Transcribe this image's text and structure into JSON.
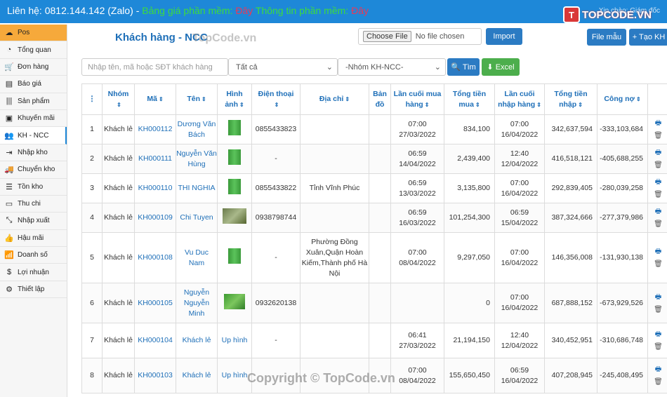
{
  "topbar": {
    "contact_label": "Liên hệ: 0812.144.142 (Zalo) -",
    "price_label": "Bảng giá phần mềm:",
    "price_link": "Đây",
    "info_label": "Thông tin phần mềm:",
    "info_link": "Đây",
    "welcome": "Xin chào: Giám đốc",
    "logo_mark": "T",
    "logo_text": "TOPCODE.VN"
  },
  "sidebar": {
    "items": [
      {
        "label": "Pos",
        "icon": "cloud-icon"
      },
      {
        "label": "Tổng quan",
        "icon": "dashboard-icon"
      },
      {
        "label": "Đơn hàng",
        "icon": "cart-icon"
      },
      {
        "label": "Báo giá",
        "icon": "document-icon"
      },
      {
        "label": "Sản phẩm",
        "icon": "barcode-icon"
      },
      {
        "label": "Khuyến mãi",
        "icon": "gift-icon"
      },
      {
        "label": "KH - NCC",
        "icon": "users-icon"
      },
      {
        "label": "Nhập kho",
        "icon": "import-icon"
      },
      {
        "label": "Chuyển kho",
        "icon": "truck-icon"
      },
      {
        "label": "Tồn kho",
        "icon": "inventory-icon"
      },
      {
        "label": "Thu chi",
        "icon": "money-icon"
      },
      {
        "label": "Nhập xuất",
        "icon": "arrows-icon"
      },
      {
        "label": "Hậu mãi",
        "icon": "thumb-icon"
      },
      {
        "label": "Doanh số",
        "icon": "chart-icon"
      },
      {
        "label": "Lợi nhuận",
        "icon": "dollar-icon"
      },
      {
        "label": "Thiết lập",
        "icon": "settings-icon"
      }
    ]
  },
  "header": {
    "title": "Khách hàng - NCC",
    "choose_file": "Choose File",
    "no_file": "No file chosen",
    "import_label": "Import",
    "template_label": "File mẫu",
    "create_label": "+ Tạo KH"
  },
  "filters": {
    "search_placeholder": "Nhập tên, mã hoặc SĐT khách hàng",
    "status_value": "Tất cả",
    "group_value": "-Nhóm KH-NCC-",
    "search_button": "Tìm",
    "excel_button": "Excel"
  },
  "table": {
    "headers": [
      "",
      "Nhóm",
      "Mã",
      "Tên",
      "Hình ảnh",
      "Điện thoại",
      "Địa chỉ",
      "Bản đồ",
      "Lần cuối mua hàng",
      "Tổng tiền mua",
      "Lần cuối nhập hàng",
      "Tổng tiền nhập",
      "Công nợ",
      ""
    ],
    "rows": [
      {
        "no": "1",
        "group": "Khách lẻ",
        "code": "KH000112",
        "name": "Dương Văn Bách",
        "image": "thumb",
        "phone": "0855433823",
        "address": "",
        "last_buy": "07:00 27/03/2022",
        "total_buy": "834,100",
        "last_import": "07:00 16/04/2022",
        "total_import": "342,637,594",
        "debt": "-333,103,684"
      },
      {
        "no": "2",
        "group": "Khách lẻ",
        "code": "KH000111",
        "name": "Nguyễn Văn Hùng",
        "image": "thumb",
        "phone": "-",
        "address": "",
        "last_buy": "06:59 14/04/2022",
        "total_buy": "2,439,400",
        "last_import": "12:40 12/04/2022",
        "total_import": "416,518,121",
        "debt": "-405,688,255"
      },
      {
        "no": "3",
        "group": "Khách lẻ",
        "code": "KH000110",
        "name": "THI NGHIA",
        "image": "thumb",
        "phone": "0855433822",
        "address": "Tỉnh Vĩnh Phúc",
        "last_buy": "06:59 13/03/2022",
        "total_buy": "3,135,800",
        "last_import": "07:00 16/04/2022",
        "total_import": "292,839,405",
        "debt": "-280,039,258"
      },
      {
        "no": "4",
        "group": "Khách lẻ",
        "code": "KH000109",
        "name": "Chi Tuyen",
        "image": "wide",
        "phone": "0938798744",
        "address": "",
        "last_buy": "06:59 16/03/2022",
        "total_buy": "101,254,300",
        "last_import": "06:59 15/04/2022",
        "total_import": "387,324,666",
        "debt": "-277,379,986"
      },
      {
        "no": "5",
        "group": "Khách lẻ",
        "code": "KH000108",
        "name": "Vu Duc Nam",
        "image": "thumb",
        "phone": "-",
        "address": "Phường Đồng Xuân,Quận Hoàn Kiếm,Thành phố Hà Nội",
        "last_buy": "07:00 08/04/2022",
        "total_buy": "9,297,050",
        "last_import": "07:00 16/04/2022",
        "total_import": "146,356,008",
        "debt": "-131,930,138"
      },
      {
        "no": "6",
        "group": "Khách lẻ",
        "code": "KH000105",
        "name": "Nguyễn Nguyễn Minh",
        "image": "wide2",
        "phone": "0932620138",
        "address": "",
        "last_buy": "",
        "total_buy": "0",
        "last_import": "07:00 16/04/2022",
        "total_import": "687,888,152",
        "debt": "-673,929,526"
      },
      {
        "no": "7",
        "group": "Khách lẻ",
        "code": "KH000104",
        "name": "Khách lẻ",
        "image": "Up hình",
        "phone": "-",
        "address": "",
        "last_buy": "06:41 27/03/2022",
        "total_buy": "21,194,150",
        "last_import": "12:40 12/04/2022",
        "total_import": "340,452,951",
        "debt": "-310,686,748"
      },
      {
        "no": "8",
        "group": "Khách lẻ",
        "code": "KH000103",
        "name": "Khách lẻ",
        "image": "Up hình",
        "phone": "",
        "address": "",
        "last_buy": "07:00 08/04/2022",
        "total_buy": "155,650,450",
        "last_import": "06:59 16/04/2022",
        "total_import": "407,208,945",
        "debt": "-245,408,495"
      }
    ]
  },
  "watermarks": {
    "top": "TopCode.vn",
    "bottom": "Copyright © TopCode.vn"
  }
}
